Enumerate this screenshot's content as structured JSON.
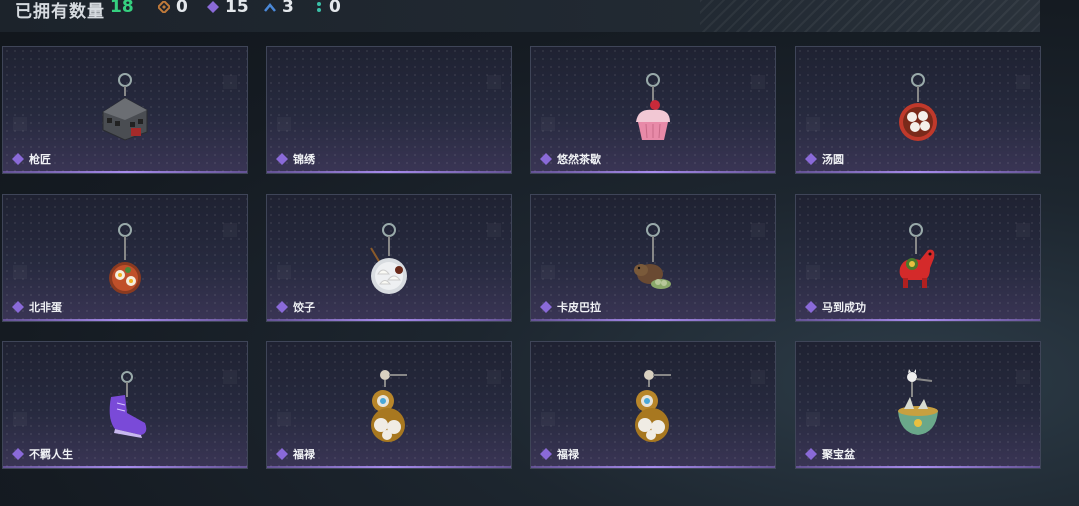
{
  "header": {
    "owned_label": "已拥有数量",
    "owned_count": "18",
    "stats": [
      {
        "icon": "orange-diamond-icon",
        "color": "#c07a3a",
        "value": "0"
      },
      {
        "icon": "purple-diamond-icon",
        "color": "#8a6ad8",
        "value": "15"
      },
      {
        "icon": "blue-chevron-icon",
        "color": "#4a88d8",
        "value": "3"
      },
      {
        "icon": "teal-dots-icon",
        "color": "#3ac0a8",
        "value": "0"
      }
    ]
  },
  "colors": {
    "accent_green": "#35d07f",
    "rarity_purple": "#8a6ad8"
  },
  "items": [
    {
      "name": "枪匠",
      "icon": "building-charm-icon",
      "rarity": "purple"
    },
    {
      "name": "锦绣",
      "icon": "",
      "rarity": "purple"
    },
    {
      "name": "悠然茶歇",
      "icon": "cupcake-charm-icon",
      "rarity": "purple"
    },
    {
      "name": "汤圆",
      "icon": "tangyuan-bowl-charm-icon",
      "rarity": "purple"
    },
    {
      "name": "北非蛋",
      "icon": "shakshuka-charm-icon",
      "rarity": "purple"
    },
    {
      "name": "饺子",
      "icon": "dumpling-plate-charm-icon",
      "rarity": "purple"
    },
    {
      "name": "卡皮巴拉",
      "icon": "capybara-charm-icon",
      "rarity": "purple"
    },
    {
      "name": "马到成功",
      "icon": "red-horse-charm-icon",
      "rarity": "purple"
    },
    {
      "name": "不羁人生",
      "icon": "sneaker-charm-icon",
      "rarity": "purple"
    },
    {
      "name": "福禄",
      "icon": "gourd-charm-icon",
      "rarity": "purple"
    },
    {
      "name": "福禄",
      "icon": "gourd-charm-icon",
      "rarity": "purple"
    },
    {
      "name": "聚宝盆",
      "icon": "treasure-bowl-charm-icon",
      "rarity": "purple"
    }
  ]
}
